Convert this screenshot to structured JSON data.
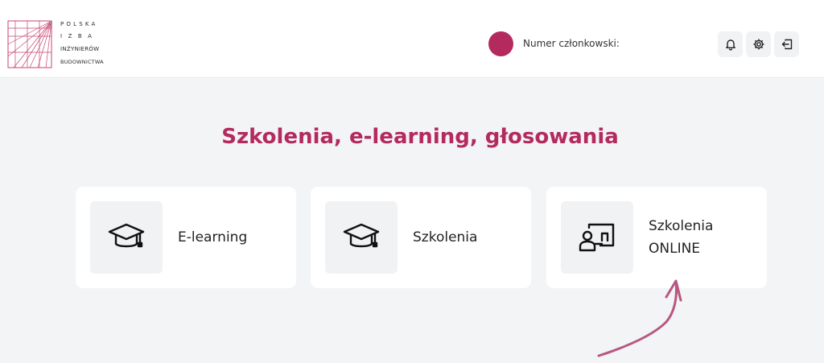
{
  "brand": {
    "lines": [
      "POLSKA",
      "IZBA",
      "INŻYNIERÓW",
      "BUDOWNICTWA"
    ],
    "accent": "#b42a5e"
  },
  "header": {
    "member_label": "Numer członkowski:",
    "icons": [
      "bell-icon",
      "gear-icon",
      "logout-icon"
    ]
  },
  "main": {
    "title": "Szkolenia, e-learning, głosowania",
    "cards": [
      {
        "label": "E-learning",
        "icon": "graduation-cap-icon"
      },
      {
        "label": "Szkolenia",
        "icon": "graduation-cap-icon"
      },
      {
        "label_lines": [
          "Szkolenia",
          "ONLINE"
        ],
        "icon": "online-training-icon"
      }
    ]
  },
  "colors": {
    "background": "#f2f4f6",
    "card": "#ffffff",
    "accent": "#b42a5e"
  }
}
